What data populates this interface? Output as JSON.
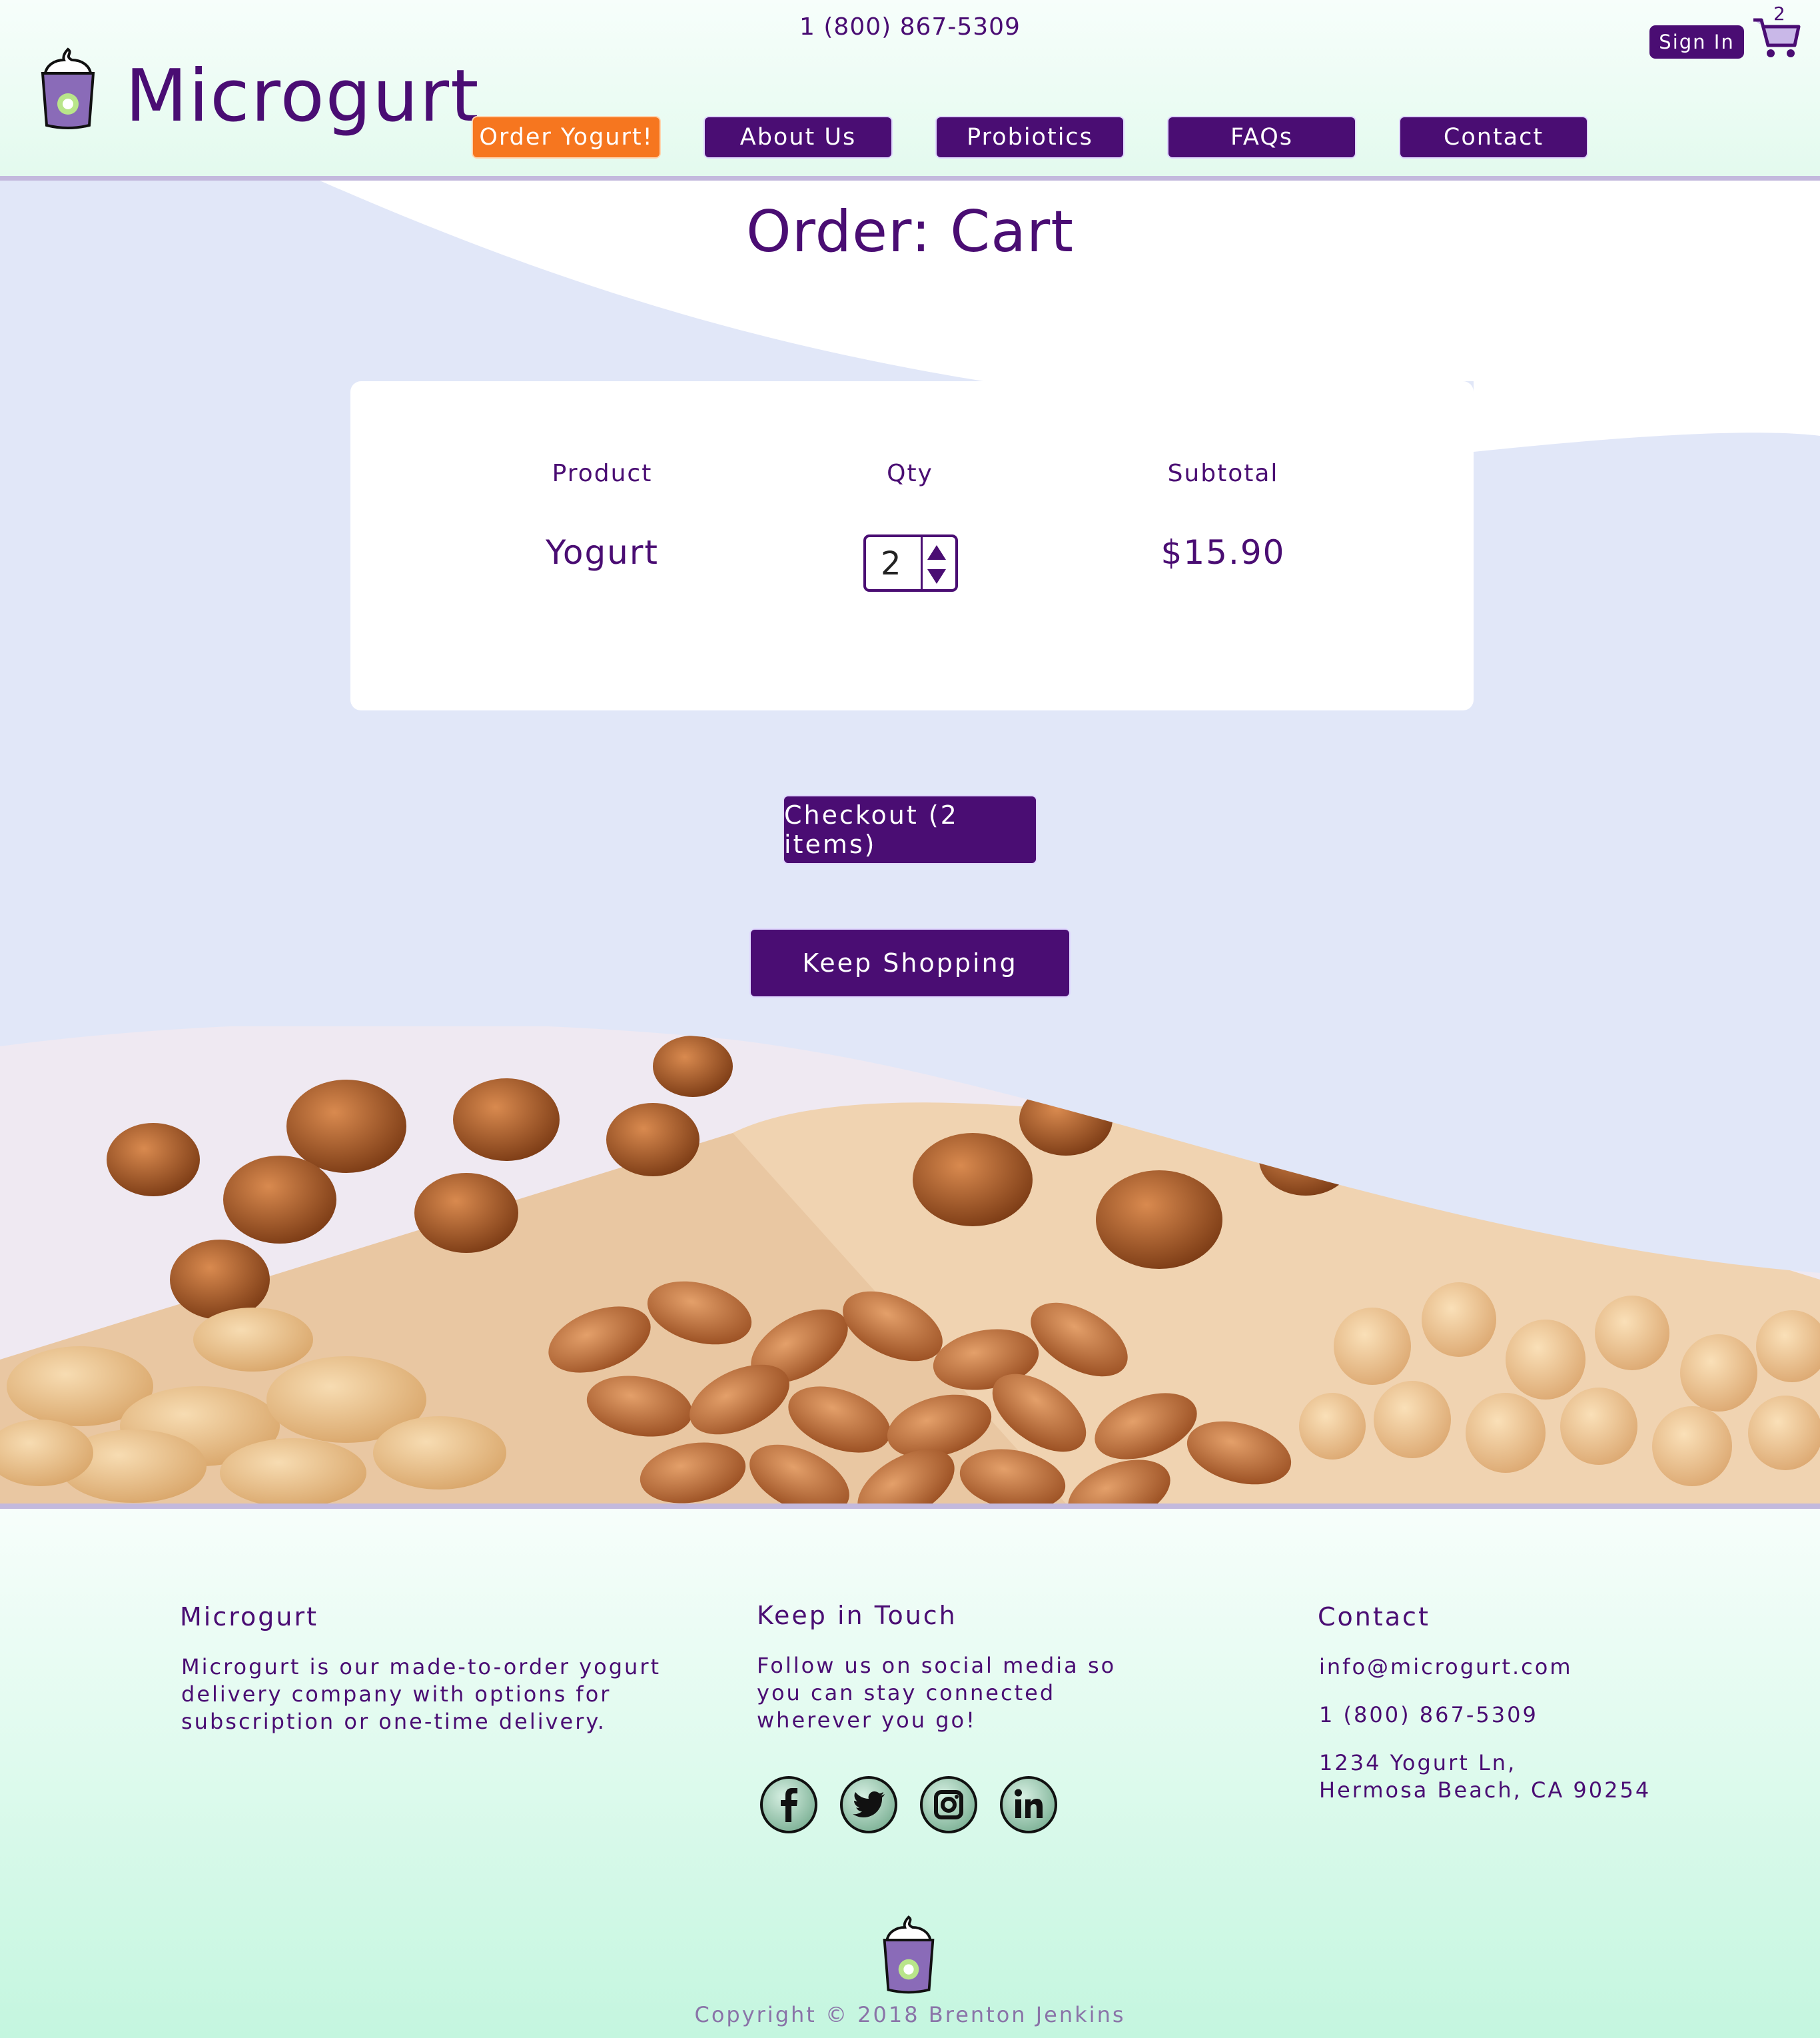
{
  "header": {
    "phone": "1 (800) 867-5309",
    "brand": "Microgurt",
    "signin_label": "Sign In",
    "cart_count": "2",
    "nav": [
      {
        "label": "Order Yogurt!"
      },
      {
        "label": "About Us"
      },
      {
        "label": "Probiotics"
      },
      {
        "label": "FAQs"
      },
      {
        "label": "Contact"
      }
    ]
  },
  "main": {
    "title": "Order: Cart",
    "columns": {
      "product": "Product",
      "qty": "Qty",
      "subtotal": "Subtotal"
    },
    "row": {
      "product": "Yogurt",
      "qty": "2",
      "subtotal": "$15.90"
    },
    "checkout_label": "Checkout (2 items)",
    "keep_shopping_label": "Keep Shopping"
  },
  "footer": {
    "about": {
      "heading": "Microgurt",
      "lines": [
        "Microgurt is our made-to-order yogurt",
        "delivery company with options for",
        "subscription or one-time delivery."
      ]
    },
    "social": {
      "heading": "Keep in Touch",
      "lines": [
        "Follow us on social media so",
        "you can stay connected",
        "wherever you go!"
      ],
      "icons": [
        "facebook-icon",
        "twitter-icon",
        "instagram-icon",
        "linkedin-icon"
      ]
    },
    "contact": {
      "heading": "Contact",
      "email": "info@microgurt.com",
      "phone": "1 (800) 867-5309",
      "address_line1": "1234 Yogurt Ln,",
      "address_line2": "Hermosa Beach, CA 90254"
    },
    "copyright": "Copyright © 2018 Brenton Jenkins"
  },
  "colors": {
    "brand_purple": "#4a0d73",
    "accent_orange": "#f6761f",
    "main_bg": "#e1e7f8",
    "footer_mint": "#c4f6df"
  }
}
